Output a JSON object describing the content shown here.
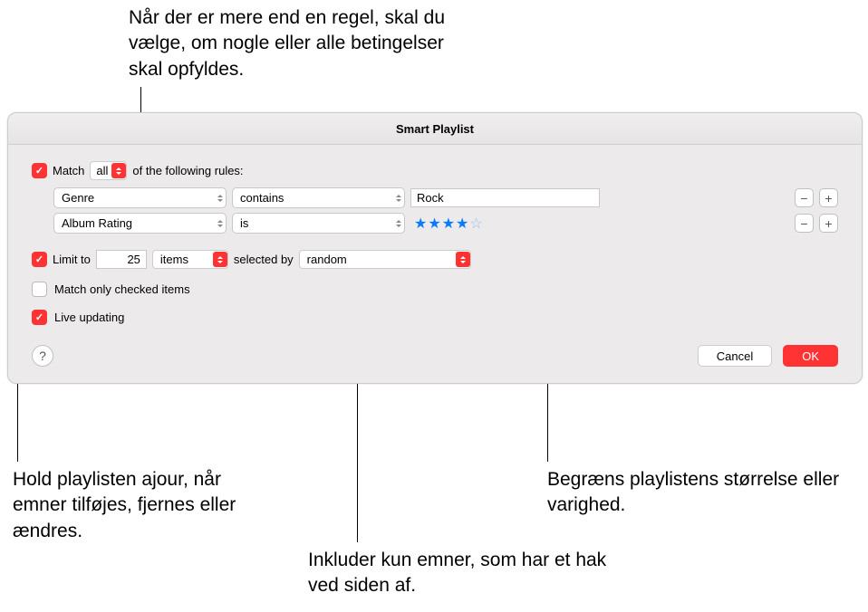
{
  "callouts": {
    "top": "Når der er mere end en regel, skal du vælge, om nogle eller alle betingelser skal opfyldes.",
    "bottom_left": "Hold playlisten ajour, når emner tilføjes, fjernes eller ændres.",
    "bottom_center": "Inkluder kun emner, som har et hak ved siden af.",
    "bottom_right": "Begræns playlistens størrelse eller varighed."
  },
  "window": {
    "title": "Smart Playlist"
  },
  "match": {
    "label_before": "Match",
    "mode": "all",
    "label_after": "of the following rules:"
  },
  "rules": [
    {
      "field": "Genre",
      "op": "contains",
      "value": "Rock",
      "type": "text"
    },
    {
      "field": "Album Rating",
      "op": "is",
      "stars": 4,
      "type": "stars"
    }
  ],
  "limit": {
    "label": "Limit to",
    "value": "25",
    "unit": "items",
    "selected_by_label": "selected by",
    "selected_by": "random"
  },
  "match_only": {
    "label": "Match only checked items"
  },
  "live": {
    "label": "Live updating"
  },
  "buttons": {
    "cancel": "Cancel",
    "ok": "OK"
  },
  "help": "?"
}
